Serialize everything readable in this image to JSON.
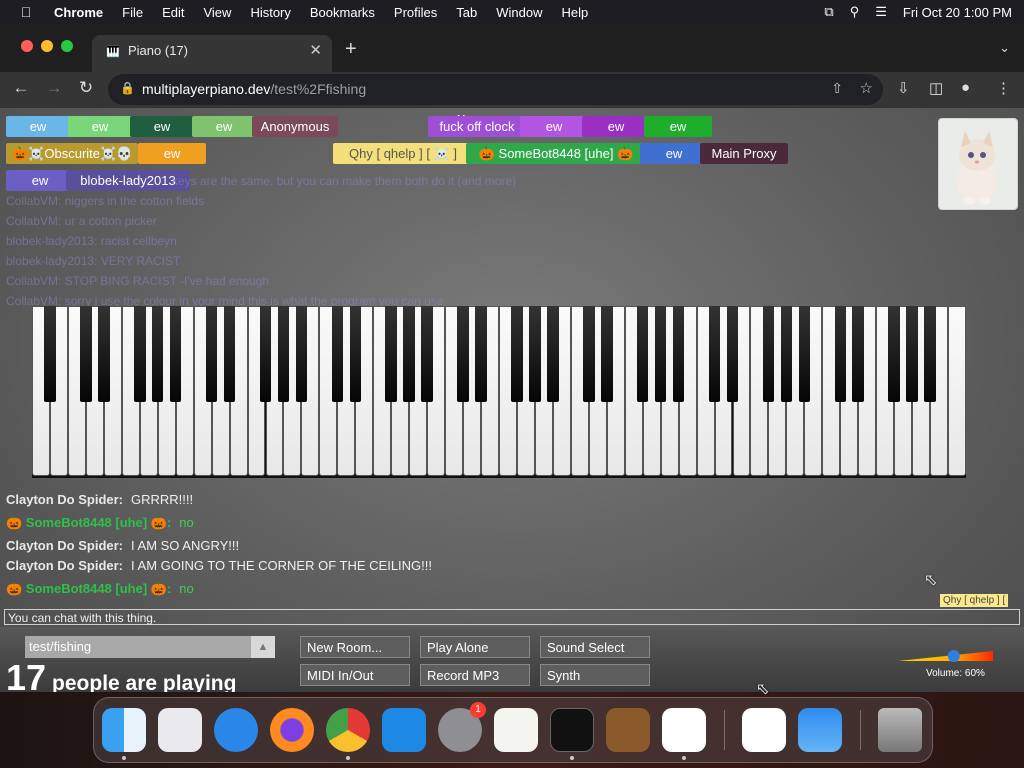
{
  "menubar": {
    "app": "Chrome",
    "items": [
      "File",
      "Edit",
      "View",
      "History",
      "Bookmarks",
      "Profiles",
      "Tab",
      "Window",
      "Help"
    ],
    "datetime": "Fri Oct 20  1:00 PM"
  },
  "tab": {
    "title": "Piano (17)"
  },
  "toolbar": {
    "url_host": "multiplayerpiano.dev",
    "url_path": "/test%2Ffishing"
  },
  "players": {
    "me_label": "Me",
    "tags": [
      {
        "name": "ew",
        "color": "#6bb6e8"
      },
      {
        "name": "ew",
        "color": "#79d67a"
      },
      {
        "name": "ew",
        "color": "#1f5f3f"
      },
      {
        "name": "ew",
        "color": "#7fc36f"
      },
      {
        "name": "Anonymous",
        "color": "#7a4a5a"
      },
      {
        "name": "fuck off clock",
        "color": "#9e4fd6"
      },
      {
        "name": "ew",
        "color": "#b355e3"
      },
      {
        "name": "ew",
        "color": "#9b2fc4"
      },
      {
        "name": "ew",
        "color": "#1fae2c"
      },
      {
        "name": "🎃☠️Obscurite☠️💀",
        "color": "#b89a2e"
      },
      {
        "name": "ew",
        "color": "#f0a020"
      },
      {
        "name": "Qhy [ qhelp ] [ ☠️ ]",
        "color": "#f3e07a"
      },
      {
        "name": "🎃 SomeBot8448 [uhe] 🎃",
        "color": "#2fa84a"
      },
      {
        "name": "ew",
        "color": "#3f6fd0"
      },
      {
        "name": "Main Proxy",
        "color": "#4a2a3a"
      },
      {
        "name": "ew",
        "color": "#6a5fc4"
      },
      {
        "name": "blobek-lady2013",
        "color": "#5a4f9a"
      }
    ]
  },
  "faded_chat": [
    "keys are the same, but you can make them both do it  (and more)",
    "CollabVM:  niggers in the cotton fields",
    "CollabVM:  ur a cotton picker",
    "blobek-lady2013:  racist cellbeyn",
    "blobek-lady2013:  VERY RACIST",
    "CollabVM:  STOP BING RACIST -I've had enough",
    "CollabVM:  sorry i use the colour in your mind this is what the program you can use"
  ],
  "chat": [
    {
      "name": "Clayton Do Spider:",
      "name_color": "#e8e8e8",
      "message": "GRRRR!!!!",
      "msg_color": "#f0f0f0"
    },
    {
      "name": "🎃 SomeBot8448 [uhe] 🎃:",
      "name_color": "#2fbf4a",
      "message": "no",
      "msg_color": "#44cc55"
    },
    {
      "name": "Clayton Do Spider:",
      "name_color": "#e8e8e8",
      "message": "I AM SO ANGRY!!!",
      "msg_color": "#f0f0f0"
    },
    {
      "name": "Clayton Do Spider:",
      "name_color": "#e8e8e8",
      "message": "I AM GOING TO THE CORNER OF THE CEILING!!!",
      "msg_color": "#f0f0f0"
    },
    {
      "name": "🎃 SomeBot8448 [uhe] 🎃:",
      "name_color": "#2fbf4a",
      "message": "no",
      "msg_color": "#44cc55"
    }
  ],
  "chat_input_placeholder": "You can chat with this thing.",
  "tooltip": "Qhy [ qhelp ] [",
  "bottom": {
    "room": "test/fishing",
    "count": "17",
    "count_text": "people are playing",
    "buttons": [
      "New Room...",
      "Play Alone",
      "Sound Select",
      "MIDI In/Out",
      "Record MP3",
      "Synth"
    ],
    "volume_label": "Volume: 60%",
    "volume_level": 0.6
  },
  "dock": {
    "apps": [
      "finder-icon",
      "launchpad-icon",
      "safari-icon",
      "firefox-icon",
      "chrome-icon",
      "app-store-icon",
      "system-settings-icon",
      "textedit-icon",
      "terminal-icon",
      "garageband-icon",
      "vscode-icon",
      "visual-studio-icon",
      "weather-icon",
      "trash-icon"
    ],
    "settings_badge": "1"
  }
}
